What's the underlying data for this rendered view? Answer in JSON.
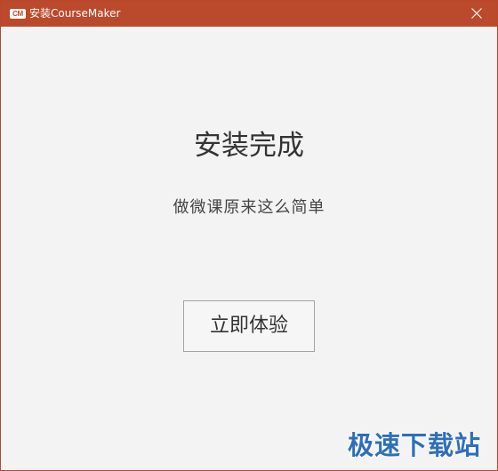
{
  "window": {
    "logo_text": "CM",
    "title": "安装CourseMaker",
    "close_icon": "close-icon"
  },
  "main": {
    "heading": "安装完成",
    "subheading": "做微课原来这么简单",
    "action_label": "立即体验"
  },
  "watermark": {
    "text": "极速下载站"
  },
  "colors": {
    "titlebar": "#bb4a2c",
    "background": "#f3f3f3",
    "watermark": "#2f6fb8"
  }
}
